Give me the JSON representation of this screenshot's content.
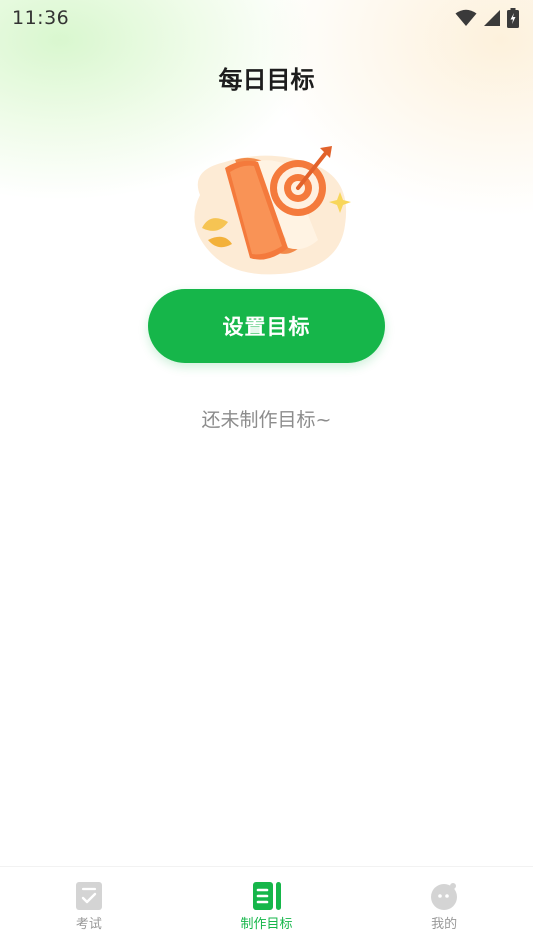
{
  "status_bar": {
    "time": "11:36"
  },
  "header": {
    "title": "每日目标"
  },
  "main": {
    "set_goal_button": "设置目标",
    "empty_message": "还未制作目标~"
  },
  "tab_bar": {
    "tabs": [
      {
        "label": "考试",
        "icon": "exam-icon",
        "active": false
      },
      {
        "label": "制作目标",
        "icon": "goal-icon",
        "active": true
      },
      {
        "label": "我的",
        "icon": "profile-icon",
        "active": false
      }
    ]
  },
  "colors": {
    "accent": "#16b64a",
    "inactive": "#999999",
    "illustration_orange": "#f47a3c"
  }
}
